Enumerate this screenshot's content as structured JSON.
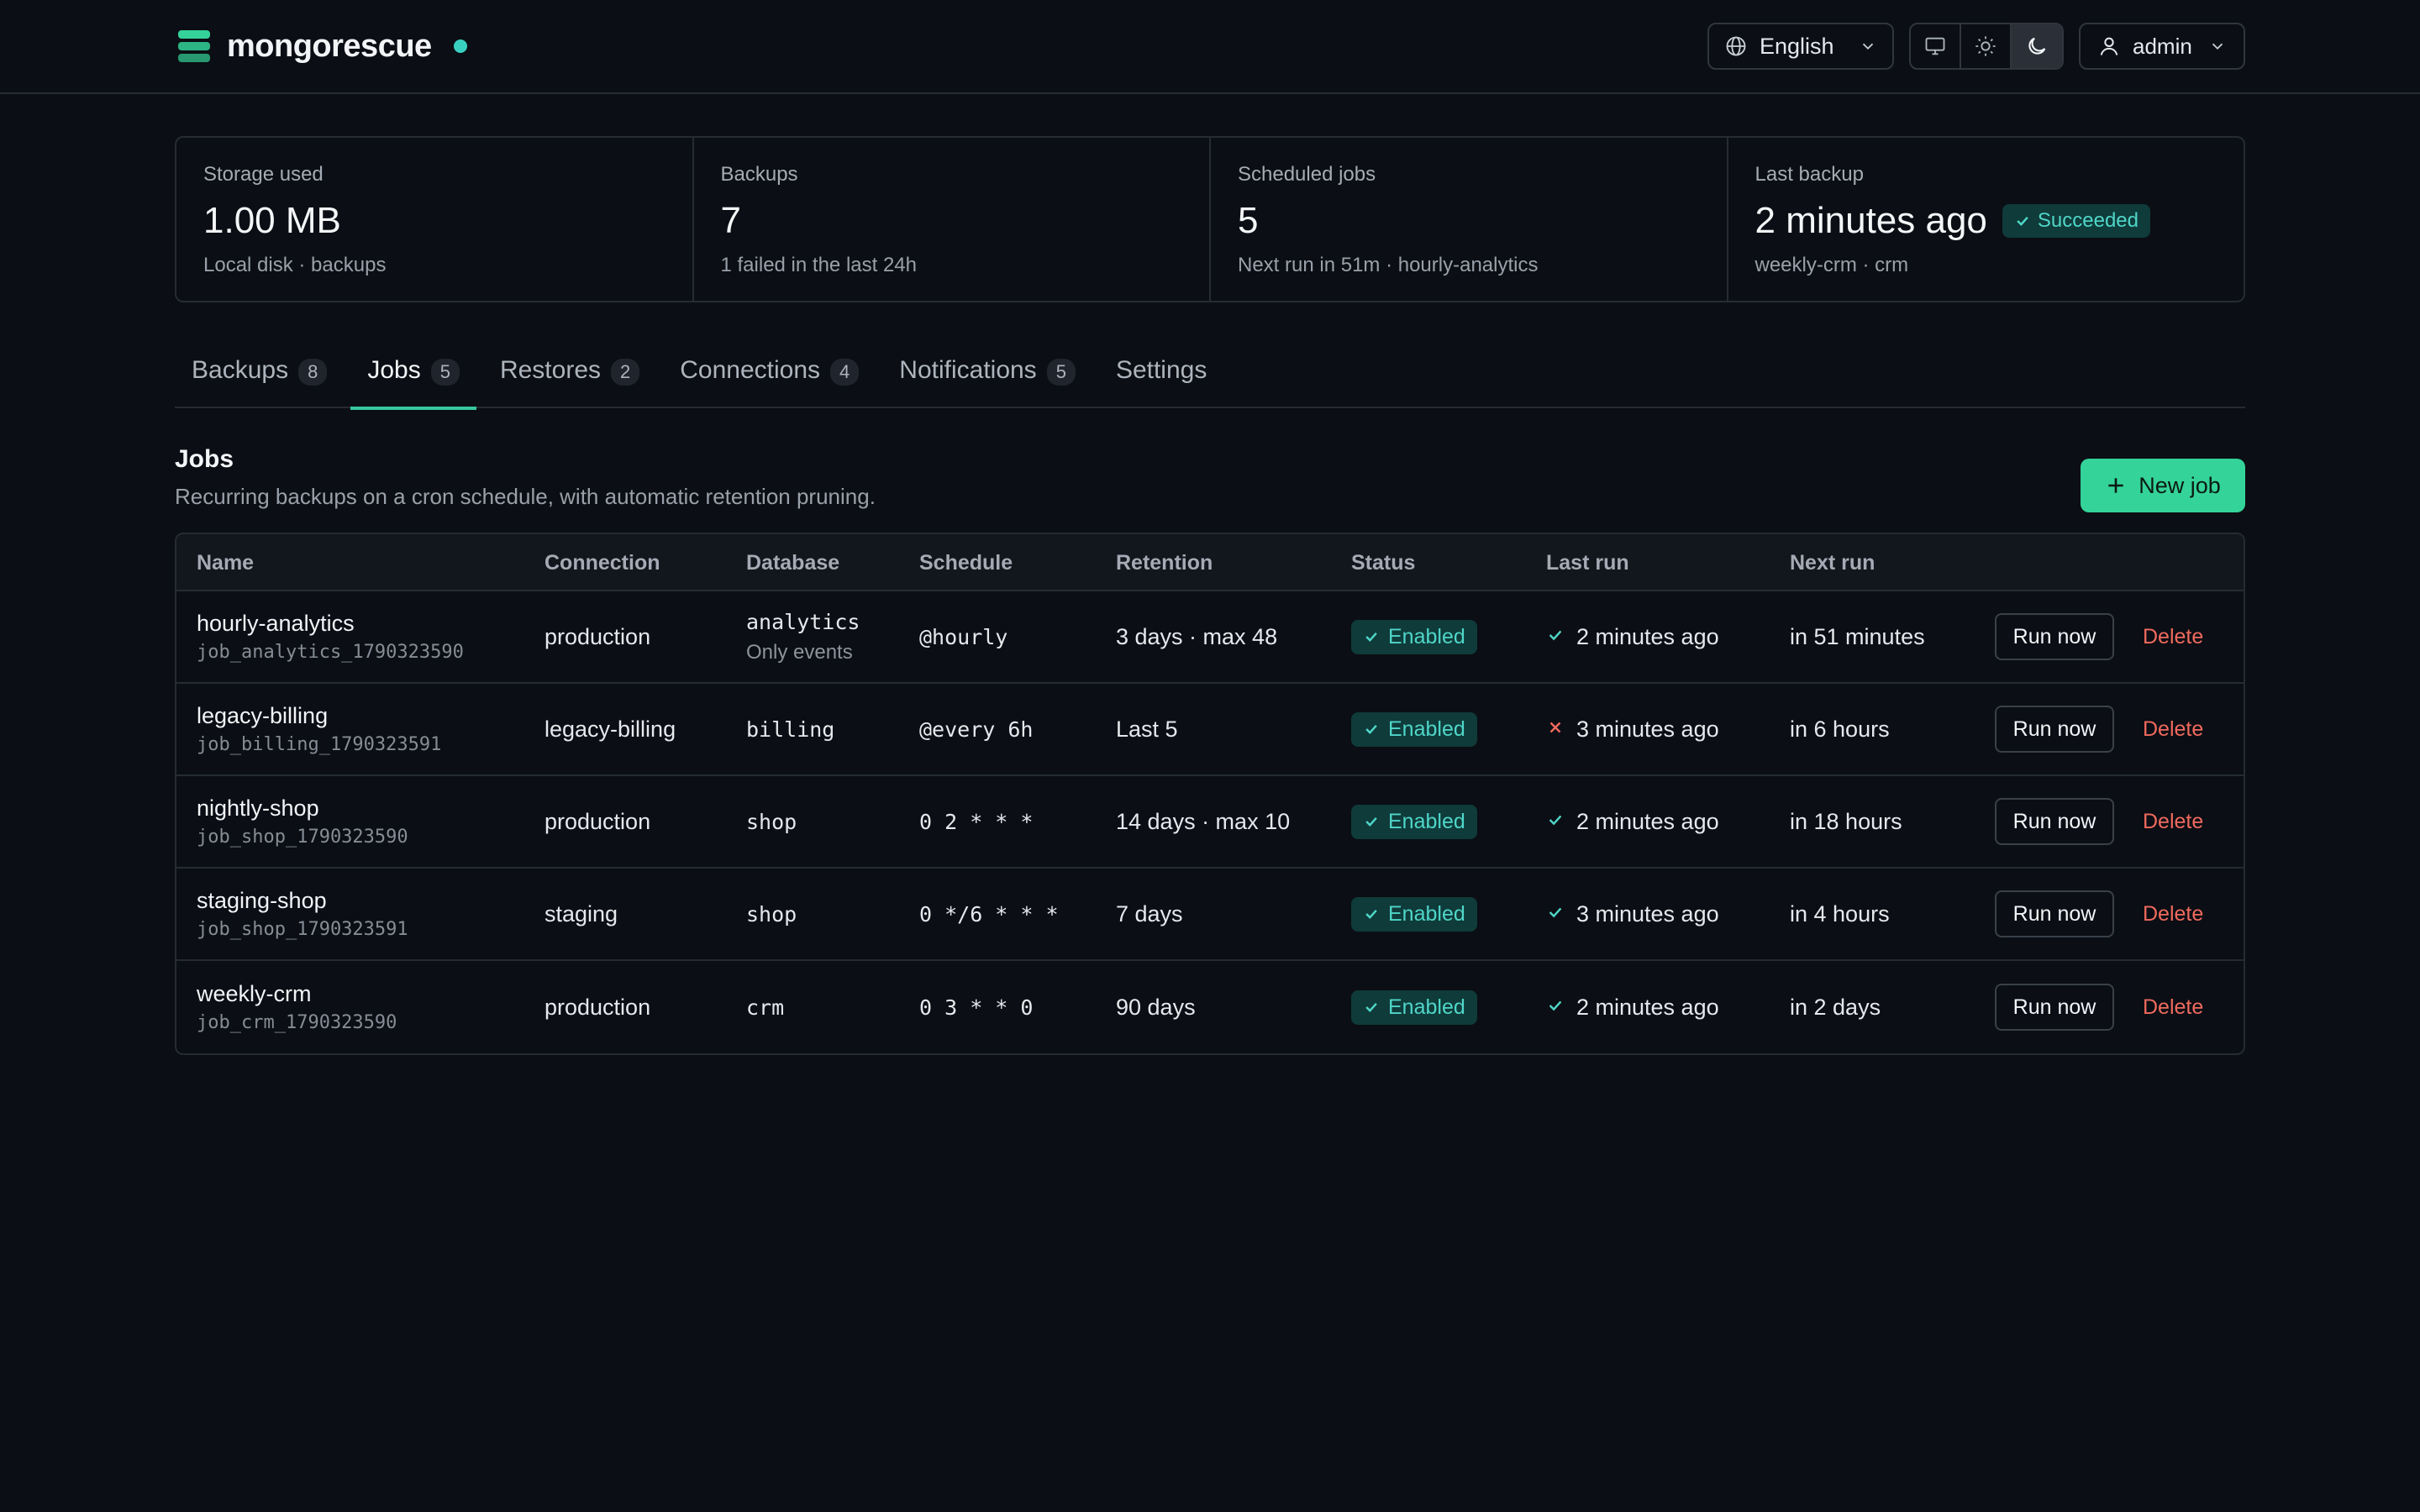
{
  "app": {
    "name": "mongorescue"
  },
  "header": {
    "language": "English",
    "theme_options": [
      "system-icon",
      "sun-icon",
      "moon-icon"
    ],
    "theme_active": "dark",
    "user": "admin"
  },
  "stats": [
    {
      "label": "Storage used",
      "value": "1.00 MB",
      "sub": "Local disk · backups"
    },
    {
      "label": "Backups",
      "value": "7",
      "sub": "1 failed in the last 24h"
    },
    {
      "label": "Scheduled jobs",
      "value": "5",
      "sub": "Next run in 51m · hourly-analytics"
    },
    {
      "label": "Last backup",
      "value": "2 minutes ago",
      "badge": "Succeeded",
      "sub": "weekly-crm · crm"
    }
  ],
  "tabs": [
    {
      "label": "Backups",
      "count": "8"
    },
    {
      "label": "Jobs",
      "count": "5"
    },
    {
      "label": "Restores",
      "count": "2"
    },
    {
      "label": "Connections",
      "count": "4"
    },
    {
      "label": "Notifications",
      "count": "5"
    },
    {
      "label": "Settings",
      "count": ""
    }
  ],
  "active_tab": "Jobs",
  "section": {
    "title": "Jobs",
    "subtitle": "Recurring backups on a cron schedule, with automatic retention pruning.",
    "new_button": "New job"
  },
  "table": {
    "columns": [
      "Name",
      "Connection",
      "Database",
      "Schedule",
      "Retention",
      "Status",
      "Last run",
      "Next run"
    ],
    "run_label": "Run now",
    "delete_label": "Delete",
    "rows": [
      {
        "name": "hourly-analytics",
        "id": "job_analytics_1790323590",
        "connection": "production",
        "database": "analytics",
        "db_note": "Only events",
        "schedule": "@hourly",
        "retention": "3 days · max 48",
        "status": "Enabled",
        "last_run": "2 minutes ago",
        "last_ok": true,
        "next_run": "in 51 minutes"
      },
      {
        "name": "legacy-billing",
        "id": "job_billing_1790323591",
        "connection": "legacy-billing",
        "database": "billing",
        "db_note": "",
        "schedule": "@every 6h",
        "retention": "Last 5",
        "status": "Enabled",
        "last_run": "3 minutes ago",
        "last_ok": false,
        "next_run": "in 6 hours"
      },
      {
        "name": "nightly-shop",
        "id": "job_shop_1790323590",
        "connection": "production",
        "database": "shop",
        "db_note": "",
        "schedule": "0 2 * * *",
        "retention": "14 days · max 10",
        "status": "Enabled",
        "last_run": "2 minutes ago",
        "last_ok": true,
        "next_run": "in 18 hours"
      },
      {
        "name": "staging-shop",
        "id": "job_shop_1790323591",
        "connection": "staging",
        "database": "shop",
        "db_note": "",
        "schedule": "0 */6 * * *",
        "retention": "7 days",
        "status": "Enabled",
        "last_run": "3 minutes ago",
        "last_ok": true,
        "next_run": "in 4 hours"
      },
      {
        "name": "weekly-crm",
        "id": "job_crm_1790323590",
        "connection": "production",
        "database": "crm",
        "db_note": "",
        "schedule": "0 3 * * 0",
        "retention": "90 days",
        "status": "Enabled",
        "last_run": "2 minutes ago",
        "last_ok": true,
        "next_run": "in 2 days"
      }
    ]
  },
  "colors": {
    "accent": "#34d399",
    "teal": "#4fd6c8",
    "danger": "#f06a5e",
    "background": "#0b0e14"
  }
}
